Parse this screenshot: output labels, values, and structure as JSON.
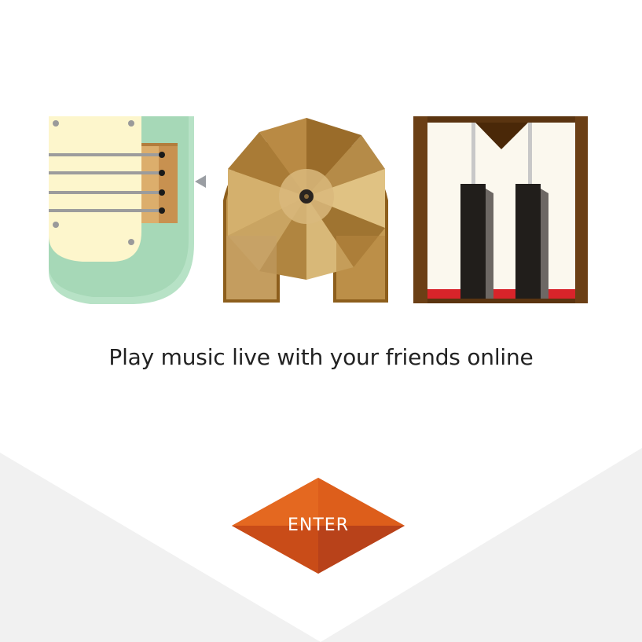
{
  "tagline": "Play music live with your friends online",
  "enter_button": {
    "label": "ENTER"
  },
  "logo": {
    "letters": [
      "guitar-letter-j",
      "record-letter-a",
      "piano-letter-m"
    ]
  },
  "colors": {
    "background": "#ffffff",
    "background_shape": "#f1f1f1",
    "guitar_body": "#a6d8b7",
    "guitar_pickguard": "#fdf6cc",
    "guitar_bridge": "#d9a968",
    "record_gold": "#c49a52",
    "record_rim": "#8d5e1c",
    "piano_frame": "#5a3410",
    "piano_white_keys": "#fbf8ee",
    "piano_black_keys": "#211e1b",
    "piano_red_strip": "#d8242a",
    "enter_button": "#d6561a",
    "tagline_text": "#222222"
  }
}
